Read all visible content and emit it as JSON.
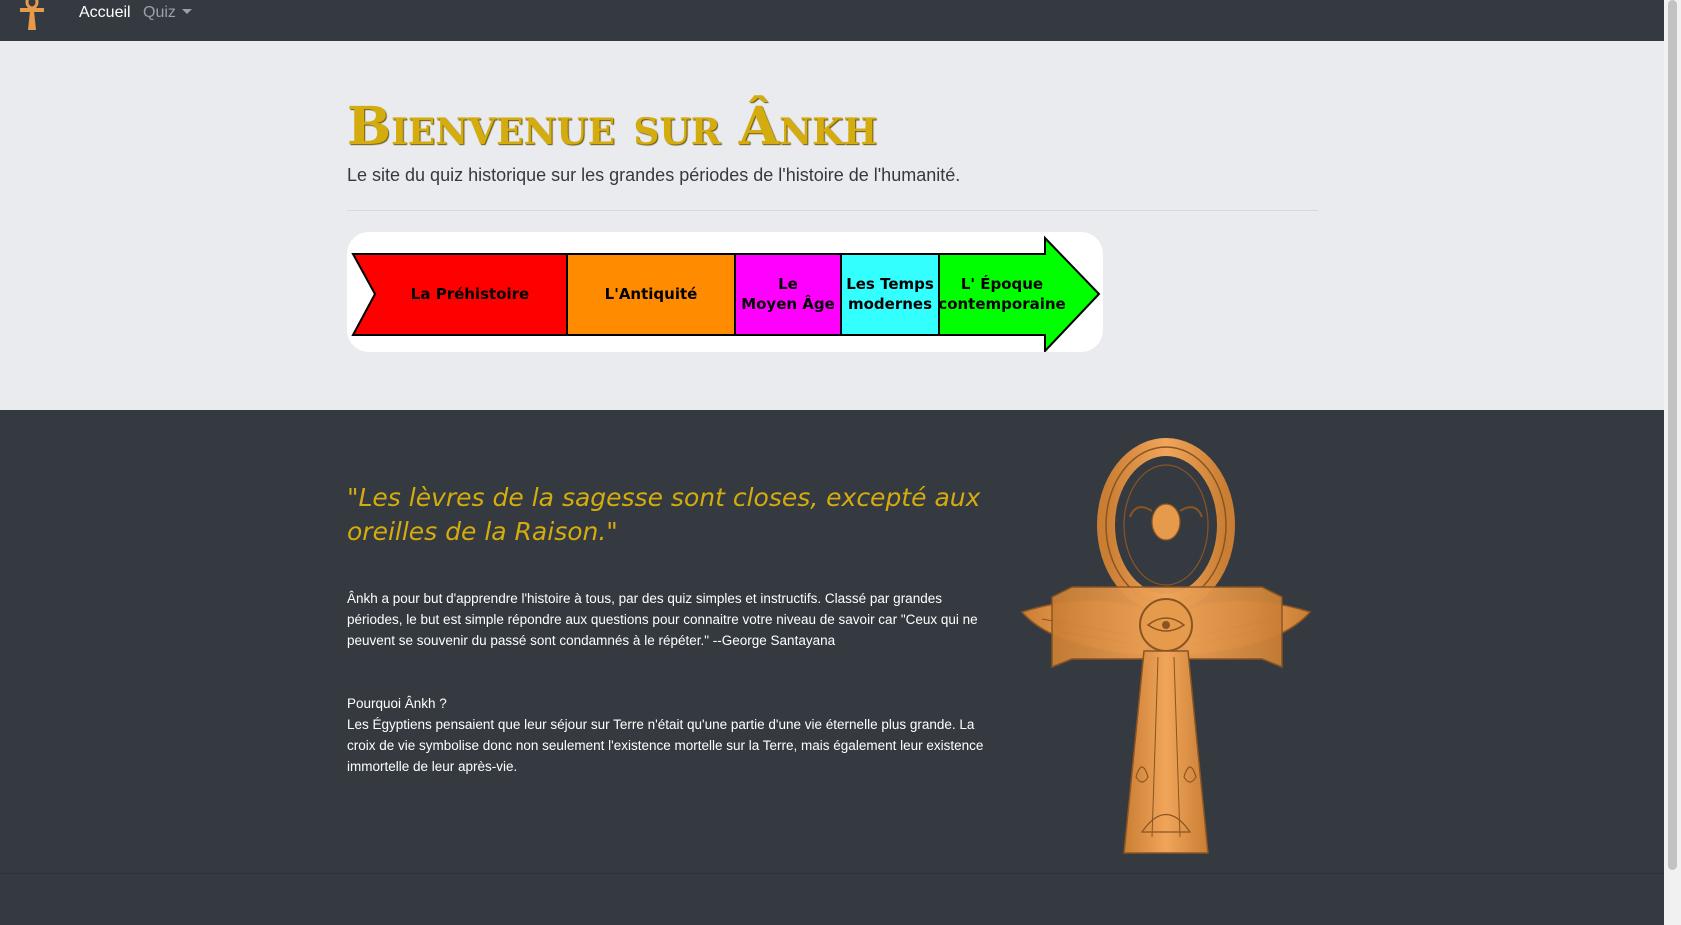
{
  "navbar": {
    "home_label": "Accueil",
    "quiz_label": "Quiz",
    "brand_icon": "ankh-icon"
  },
  "hero": {
    "title": "Bienvenue sur Ânkh",
    "subtitle": "Le site du quiz historique sur les grandes périodes de l'histoire de l'humanité."
  },
  "timeline": {
    "periods": [
      {
        "label_lines": [
          "La Préhistoire"
        ],
        "color": "#ff0000"
      },
      {
        "label_lines": [
          "L'Antiquité"
        ],
        "color": "#ff8c00"
      },
      {
        "label_lines": [
          "Le",
          "Moyen Âge"
        ],
        "color": "#ff00ff"
      },
      {
        "label_lines": [
          "Les Temps",
          "modernes"
        ],
        "color": "#33ffff"
      },
      {
        "label_lines": [
          "L' Époque",
          "contemporaine"
        ],
        "color": "#00ff00"
      }
    ]
  },
  "about": {
    "quote": "\"Les lèvres de la sagesse sont closes, excepté aux oreilles de la Raison.\"",
    "paragraph1": "Ânkh a pour but d'apprendre l'histoire à tous, par des quiz simples et instructifs. Classé par grandes périodes, le but est simple répondre aux questions pour connaitre votre niveau de savoir car \"Ceux qui ne peuvent se souvenir du passé sont condamnés à le répéter.\" --George Santayana",
    "why_title": "Pourquoi Ânkh ?",
    "why_text": "Les Égyptiens pensaient que leur séjour sur Terre n'était qu'une partie d'une vie éternelle plus grande. La croix de vie symbolise donc non seulement l'existence mortelle sur la Terre, mais également leur existence immortelle de leur après-vie.",
    "image_icon": "winged-ankh-icon"
  },
  "colors": {
    "gold": "#d4ac0d",
    "dark_bg": "#353a40",
    "light_bg": "#e9ebee",
    "ankh_orange": "#e69a4b"
  }
}
